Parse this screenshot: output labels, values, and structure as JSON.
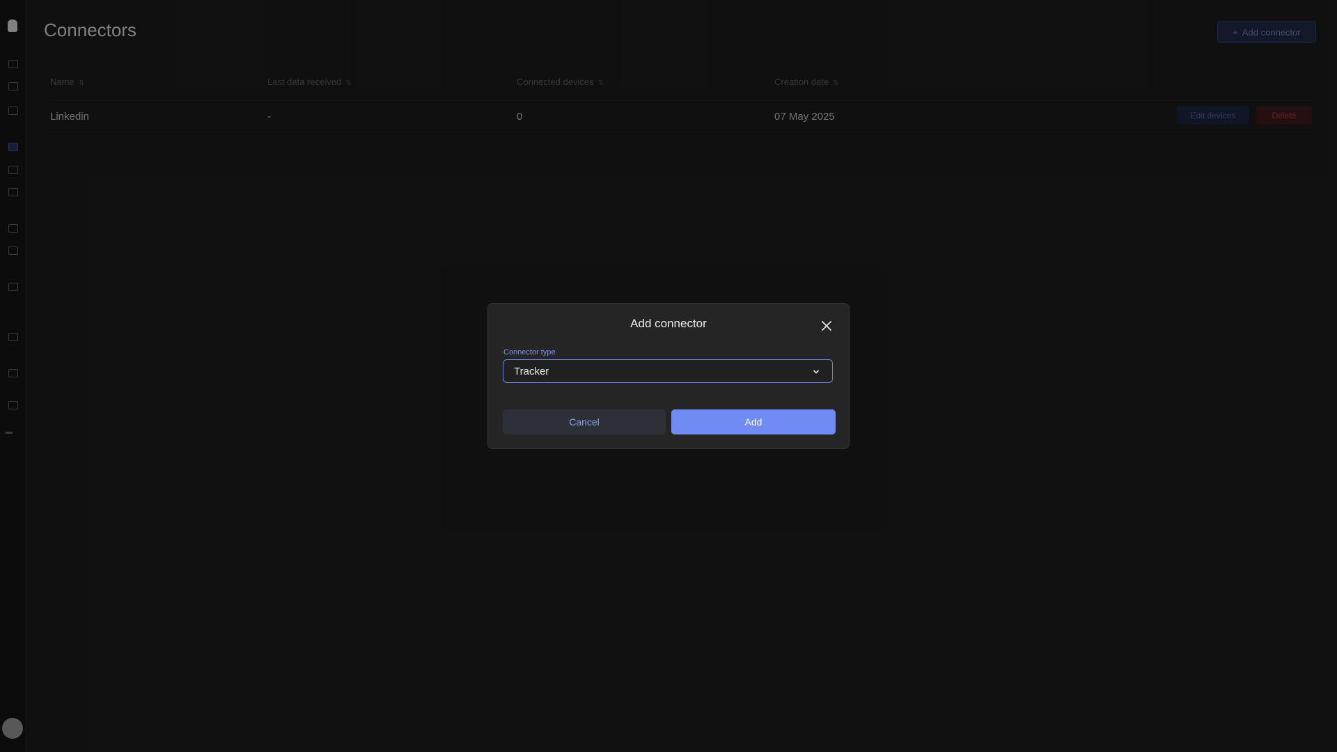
{
  "page": {
    "title": "Connectors",
    "add_button_label": "Add connector"
  },
  "table": {
    "columns": [
      "Name",
      "Last data received",
      "Connected devices",
      "Creation date"
    ],
    "rows": [
      {
        "name": "Linkedin",
        "last_data": "-",
        "devices": "0",
        "created": "07 May 2025",
        "edit_label": "Edit devices",
        "delete_label": "Delete"
      }
    ]
  },
  "modal": {
    "title": "Add connector",
    "field_label": "Connector type",
    "selected_value": "Tracker",
    "cancel_label": "Cancel",
    "add_label": "Add"
  },
  "icons": {
    "logo": "app-logo-icon",
    "close": "close-icon",
    "chevron": "chevron-down-icon",
    "sort": "sort-icon",
    "plus": "plus-icon"
  },
  "colors": {
    "accent": "#6e8cf3",
    "focus_border": "#6f86e6",
    "delete": "#a33d3d"
  }
}
